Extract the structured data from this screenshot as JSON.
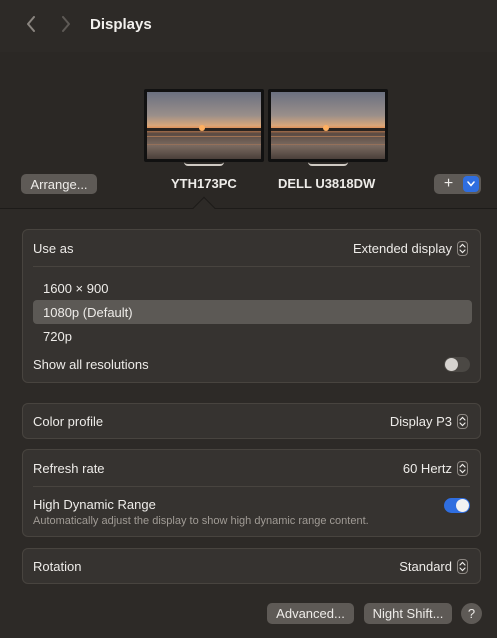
{
  "window": {
    "title": "Displays"
  },
  "nav": {
    "back_icon": "chevron-left-icon",
    "forward_icon": "chevron-right-icon"
  },
  "arrangement": {
    "arrange_label": "Arrange...",
    "displays": [
      {
        "name": "YTH173PC",
        "selected": true
      },
      {
        "name": "DELL U3818DW",
        "selected": false
      }
    ],
    "add_label": "+"
  },
  "use_as": {
    "label": "Use as",
    "value": "Extended display",
    "resolutions": [
      "1600 × 900",
      "1080p (Default)",
      "720p"
    ],
    "selected_resolution": "1080p (Default)",
    "show_all_label": "Show all resolutions",
    "show_all_enabled": false
  },
  "color_profile": {
    "label": "Color profile",
    "value": "Display P3"
  },
  "refresh": {
    "label": "Refresh rate",
    "value": "60 Hertz",
    "hdr_label": "High Dynamic Range",
    "hdr_desc": "Automatically adjust the display to show high dynamic range content.",
    "hdr_enabled": true
  },
  "rotation": {
    "label": "Rotation",
    "value": "Standard"
  },
  "footer": {
    "advanced_label": "Advanced...",
    "night_shift_label": "Night Shift...",
    "help_label": "?"
  },
  "colors": {
    "accent": "#2f6ee0",
    "background": "#2d2a27",
    "card": "#363330",
    "selected_row": "#5c5955"
  }
}
